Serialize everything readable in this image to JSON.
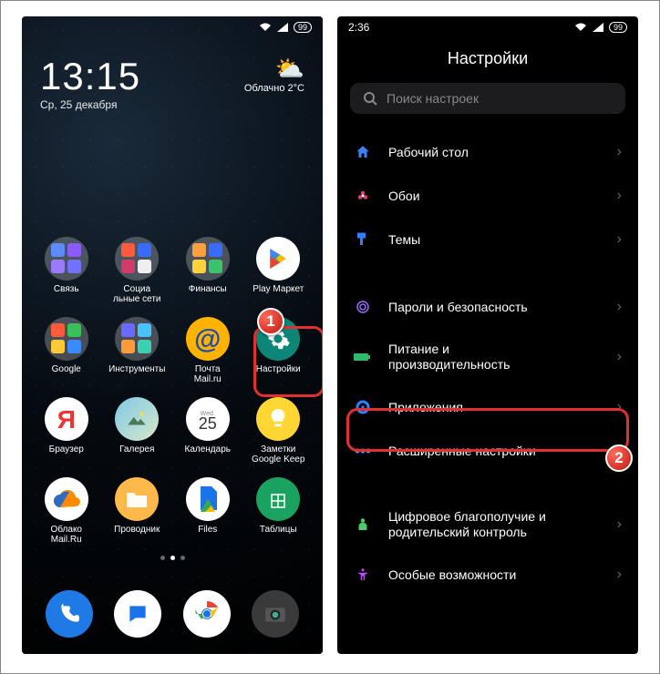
{
  "left": {
    "status": {
      "time": "",
      "battery": "99"
    },
    "clock": {
      "time": "13:15",
      "date": "Ср, 25 декабря"
    },
    "weather": {
      "condition": "Облачно",
      "temp": "2°C"
    },
    "apps": [
      {
        "label": "Связь",
        "type": "folder",
        "colors": [
          "#5c8dff",
          "#8a5cff",
          "#9a7bff",
          "#7371ff"
        ]
      },
      {
        "label": "Социа\nльные сети",
        "type": "folder",
        "colors": [
          "#ff5a3c",
          "#3a6bff",
          "#d23a6a",
          "#efefef"
        ]
      },
      {
        "label": "Финансы",
        "type": "folder",
        "colors": [
          "#ff9e3c",
          "#3a6bff",
          "#ffd23c",
          "#39c46b"
        ]
      },
      {
        "label": "Play Маркет",
        "type": "play"
      },
      {
        "label": "Google",
        "type": "folder",
        "colors": [
          "#ff5a3c",
          "#3abf5a",
          "#ffca3a",
          "#3a8bff"
        ]
      },
      {
        "label": "Инструменты",
        "type": "folder",
        "colors": [
          "#6a6aff",
          "#4ac2ff",
          "#ff9a3a",
          "#3ad0b0"
        ]
      },
      {
        "label": "Почта\nMail.ru",
        "type": "mailru"
      },
      {
        "label": "Настройки",
        "type": "settings"
      },
      {
        "label": "Браузер",
        "type": "yandex"
      },
      {
        "label": "Галерея",
        "type": "gallery"
      },
      {
        "label": "Календарь",
        "type": "calendar",
        "day": "25"
      },
      {
        "label": "Заметки\nGoogle Keep",
        "type": "keep"
      },
      {
        "label": "Облако\nMail.Ru",
        "type": "cloud"
      },
      {
        "label": "Проводник",
        "type": "files1"
      },
      {
        "label": "Files",
        "type": "files2"
      },
      {
        "label": "Таблицы",
        "type": "sheets"
      }
    ],
    "dock": [
      {
        "name": "phone",
        "bg": "#1f7ae6"
      },
      {
        "name": "messages",
        "bg": "#ffffff"
      },
      {
        "name": "chrome",
        "bg": "#ffffff"
      },
      {
        "name": "camera",
        "bg": "#3a3a3a"
      }
    ]
  },
  "right": {
    "status": {
      "time": "2:36",
      "battery": "99"
    },
    "title": "Настройки",
    "search_placeholder": "Поиск настроек",
    "items": [
      {
        "icon": "home",
        "color": "#3b82f6",
        "label": "Рабочий стол"
      },
      {
        "icon": "flower",
        "color": "#e23a7a",
        "label": "Обои"
      },
      {
        "icon": "brush",
        "color": "#2f7fff",
        "label": "Темы"
      },
      {
        "gap": true
      },
      {
        "icon": "fingerprint",
        "color": "#9a6bff",
        "label": "Пароли и безопасность"
      },
      {
        "icon": "battery",
        "color": "#2fb96b",
        "label": "Питание и\nпроизводительность"
      },
      {
        "icon": "apps",
        "color": "#2f7fff",
        "label": "Приложения"
      },
      {
        "icon": "dots",
        "color": "#5aa0ff",
        "label": "Расширенные настройки"
      },
      {
        "gap": true
      },
      {
        "icon": "wellbeing",
        "color": "#4bc96b",
        "label": "Цифровое благополучие и\nродительский контроль"
      },
      {
        "icon": "accessibility",
        "color": "#c04bff",
        "label": "Особые возможности"
      }
    ]
  },
  "callouts": {
    "one": "1",
    "two": "2"
  }
}
